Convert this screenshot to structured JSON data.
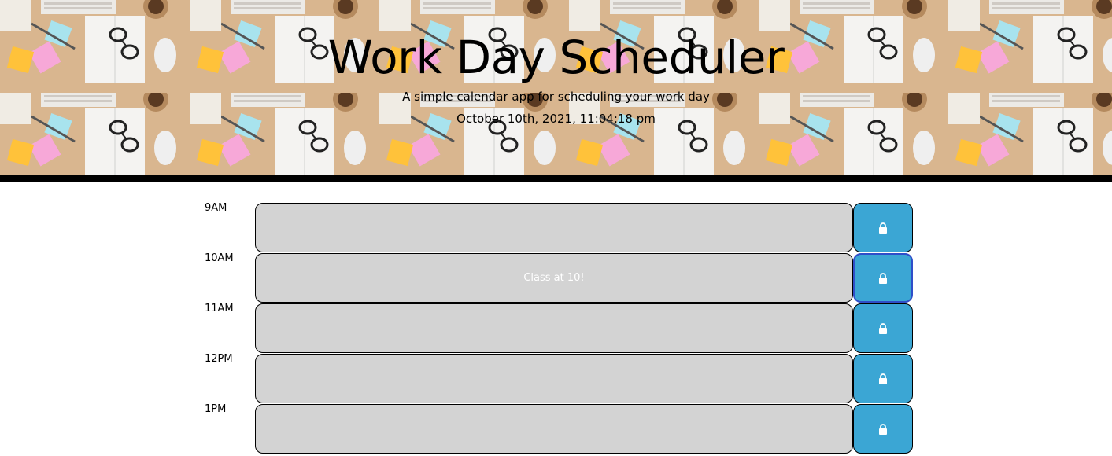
{
  "header": {
    "title": "Work Day Scheduler",
    "lead": "A simple calendar app for scheduling your work day",
    "current_day": "October 10th, 2021, 11:04:18 pm"
  },
  "colors": {
    "past": "#d3d3d3",
    "save_button": "#3ba6d4",
    "text_on_block": "#ffffff",
    "header_border": "#000000"
  },
  "schedule": {
    "blocks": [
      {
        "hour": "9AM",
        "text": "",
        "save_icon": "lock-icon"
      },
      {
        "hour": "10AM",
        "text": "Class at 10!",
        "save_icon": "lock-icon"
      },
      {
        "hour": "11AM",
        "text": "",
        "save_icon": "lock-icon"
      },
      {
        "hour": "12PM",
        "text": "",
        "save_icon": "lock-icon"
      },
      {
        "hour": "1PM",
        "text": "",
        "save_icon": "lock-icon"
      }
    ]
  }
}
